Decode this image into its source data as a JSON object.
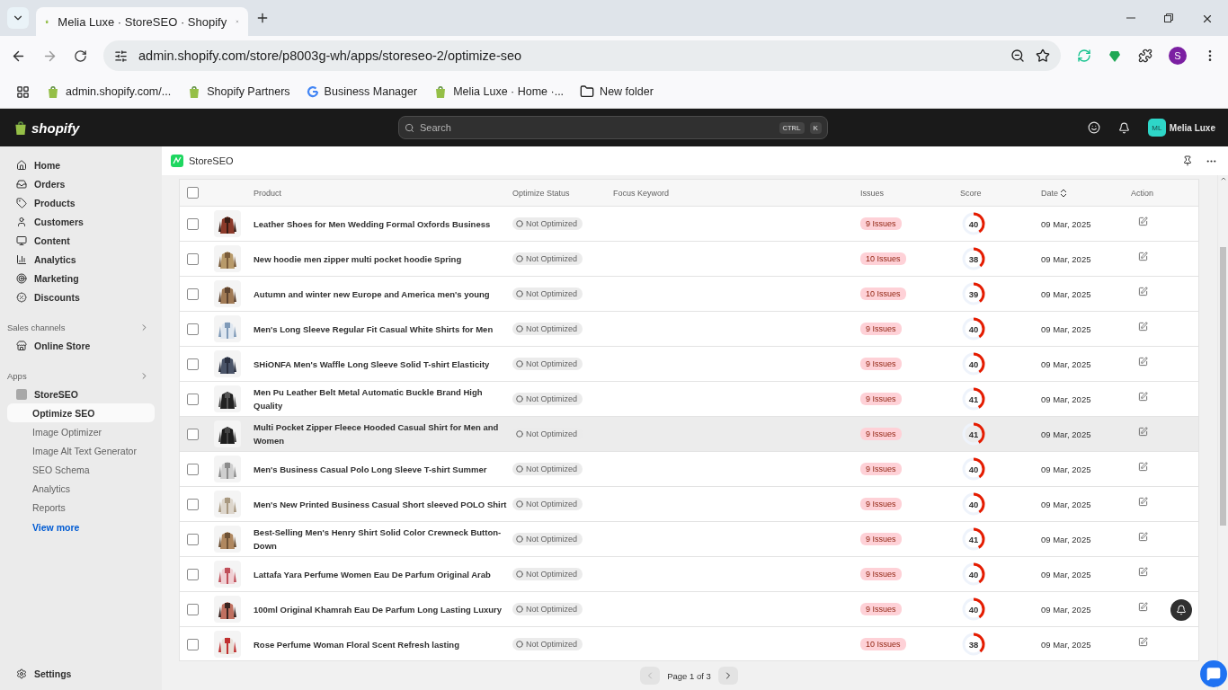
{
  "browser": {
    "tabs": [
      {
        "title": "Melia Luxe · StoreSEO · Shopify",
        "selected": true
      }
    ],
    "url": "admin.shopify.com/store/p8003g-wh/apps/storeseo-2/optimize-seo",
    "profile_initial": "S",
    "bookmarks": [
      {
        "label": "admin.shopify.com/...",
        "kind": "shopify"
      },
      {
        "label": "Shopify Partners",
        "kind": "shopify"
      },
      {
        "label": "Business Manager",
        "kind": "google"
      },
      {
        "label": "Melia Luxe · Home ·...",
        "kind": "shopify"
      },
      {
        "label": "New folder",
        "kind": "folder"
      }
    ]
  },
  "admin": {
    "logo": "shopify",
    "search_placeholder": "Search",
    "shortcut": [
      "CTRL",
      "K"
    ],
    "store_initials": "ML",
    "store_name": "Melia Luxe"
  },
  "sidebar": {
    "nav": [
      {
        "label": "Home"
      },
      {
        "label": "Orders"
      },
      {
        "label": "Products"
      },
      {
        "label": "Customers"
      },
      {
        "label": "Content"
      },
      {
        "label": "Analytics"
      },
      {
        "label": "Marketing"
      },
      {
        "label": "Discounts"
      }
    ],
    "sales_channels": {
      "title": "Sales channels",
      "items": [
        {
          "label": "Online Store"
        }
      ]
    },
    "apps": {
      "title": "Apps",
      "app": {
        "label": "StoreSEO",
        "children": [
          {
            "label": "Optimize SEO",
            "selected": true
          },
          {
            "label": "Image Optimizer",
            "selected": false
          },
          {
            "label": "Image Alt Text Generator",
            "selected": false
          },
          {
            "label": "SEO Schema",
            "selected": false
          },
          {
            "label": "Analytics",
            "selected": false
          },
          {
            "label": "Reports",
            "selected": false
          }
        ]
      }
    },
    "view_more": "View more",
    "settings": "Settings"
  },
  "app_header": {
    "title": "StoreSEO"
  },
  "table": {
    "select_all_checked": false,
    "columns": [
      "Product",
      "Optimize Status",
      "Focus Keyword",
      "Issues",
      "Score",
      "Date",
      "Action"
    ],
    "rows": [
      {
        "product": "Leather Shoes for Men Wedding Formal Oxfords Business",
        "status": "Not Optimized",
        "issues": "9 Issues",
        "score": "40",
        "level": 0.4,
        "date": "09 Mar, 2025",
        "hovered": false,
        "checked": false
      },
      {
        "product": "New hoodie men zipper multi pocket hoodie Spring",
        "status": "Not Optimized",
        "issues": "10 Issues",
        "score": "38",
        "level": 0.38,
        "date": "09 Mar, 2025",
        "hovered": false,
        "checked": false
      },
      {
        "product": "Autumn and winter new Europe and America men's young",
        "status": "Not Optimized",
        "issues": "10 Issues",
        "score": "39",
        "level": 0.39,
        "date": "09 Mar, 2025",
        "hovered": false,
        "checked": false
      },
      {
        "product": "Men's Long Sleeve Regular Fit Casual White Shirts for Men",
        "status": "Not Optimized",
        "issues": "9 Issues",
        "score": "40",
        "level": 0.4,
        "date": "09 Mar, 2025",
        "hovered": false,
        "checked": false
      },
      {
        "product": "SHiONFA Men's Waffle Long Sleeve Solid T-shirt Elasticity",
        "status": "Not Optimized",
        "issues": "9 Issues",
        "score": "40",
        "level": 0.4,
        "date": "09 Mar, 2025",
        "hovered": false,
        "checked": false
      },
      {
        "product": "Men Pu Leather Belt Metal Automatic Buckle Brand High Quality",
        "status": "Not Optimized",
        "issues": "9 Issues",
        "score": "41",
        "level": 0.41,
        "date": "09 Mar, 2025",
        "hovered": false,
        "checked": false
      },
      {
        "product": "Multi Pocket Zipper Fleece Hooded Casual Shirt for Men and Women",
        "status": "Not Optimized",
        "issues": "9 Issues",
        "score": "41",
        "level": 0.41,
        "date": "09 Mar, 2025",
        "hovered": true,
        "checked": false
      },
      {
        "product": "Men's Business Casual Polo Long Sleeve T-shirt Summer",
        "status": "Not Optimized",
        "issues": "9 Issues",
        "score": "40",
        "level": 0.4,
        "date": "09 Mar, 2025",
        "hovered": false,
        "checked": false
      },
      {
        "product": "Men's New Printed Business Casual Short sleeved POLO Shirt",
        "status": "Not Optimized",
        "issues": "9 Issues",
        "score": "40",
        "level": 0.4,
        "date": "09 Mar, 2025",
        "hovered": false,
        "checked": false
      },
      {
        "product": "Best-Selling Men's Henry Shirt Solid Color Crewneck Button-Down",
        "status": "Not Optimized",
        "issues": "9 Issues",
        "score": "41",
        "level": 0.41,
        "date": "09 Mar, 2025",
        "hovered": false,
        "checked": false
      },
      {
        "product": "Lattafa Yara Perfume Women Eau De Parfum Original Arab",
        "status": "Not Optimized",
        "issues": "9 Issues",
        "score": "40",
        "level": 0.4,
        "date": "09 Mar, 2025",
        "hovered": false,
        "checked": false
      },
      {
        "product": "100ml Original Khamrah Eau De Parfum Long Lasting Luxury",
        "status": "Not Optimized",
        "issues": "9 Issues",
        "score": "40",
        "level": 0.4,
        "date": "09 Mar, 2025",
        "hovered": false,
        "checked": false
      },
      {
        "product": "Rose Perfume Woman Floral Scent Refresh lasting",
        "status": "Not Optimized",
        "issues": "10 Issues",
        "score": "38",
        "level": 0.38,
        "date": "09 Mar, 2025",
        "hovered": false,
        "checked": false
      }
    ]
  },
  "pagination": {
    "label": "Page 1 of 3",
    "prev_disabled": true,
    "next_disabled": false
  }
}
